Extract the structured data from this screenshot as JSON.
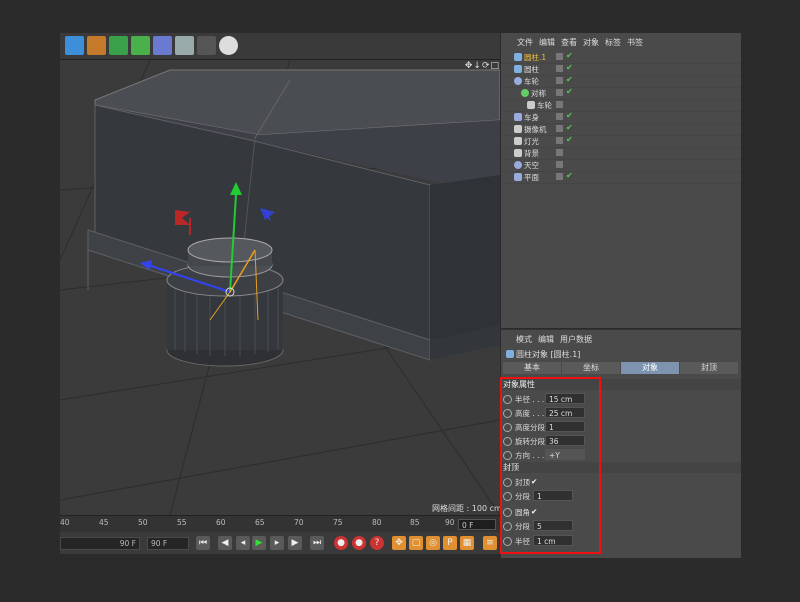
{
  "viewport": {
    "grid_spacing": "网格间距 : 100 cm",
    "nav_icons": "✥↓⟳□"
  },
  "timeline": {
    "ticks": [
      "40",
      "45",
      "50",
      "55",
      "60",
      "65",
      "70",
      "75",
      "80",
      "85",
      "90"
    ],
    "current_frame": "0 F",
    "start_frame_field": "90 F",
    "end_frame_field": "90 F"
  },
  "object_manager": {
    "menu": [
      "文件",
      "编辑",
      "查看",
      "对象",
      "标签",
      "书签"
    ],
    "objects": [
      {
        "name": "圆柱.1",
        "indent": 0,
        "icon": "cylinder-icon",
        "color": "#7fb0e0",
        "highlight": true
      },
      {
        "name": "圆柱",
        "indent": 0,
        "icon": "cylinder-icon",
        "color": "#7fb0e0"
      },
      {
        "name": "车轮",
        "indent": 0,
        "icon": "null-icon",
        "color": "#9ad"
      },
      {
        "name": "对称",
        "indent": 1,
        "icon": "symmetry-icon",
        "color": "#6c6"
      },
      {
        "name": "车轮",
        "indent": 2,
        "icon": "null-icon",
        "color": "#ccc"
      },
      {
        "name": "车身",
        "indent": 0,
        "icon": "null-icon",
        "color": "#9ad"
      },
      {
        "name": "摄像机",
        "indent": 0,
        "icon": "camera-icon",
        "color": "#ccc"
      },
      {
        "name": "灯光",
        "indent": 0,
        "icon": "light-icon",
        "color": "#ccc"
      },
      {
        "name": "背景",
        "indent": 0,
        "icon": "background-icon",
        "color": "#ccc"
      },
      {
        "name": "天空",
        "indent": 0,
        "icon": "sky-icon",
        "color": "#9ad"
      },
      {
        "name": "平面",
        "indent": 0,
        "icon": "plane-icon",
        "color": "#9ad"
      }
    ]
  },
  "attributes": {
    "menu": [
      "模式",
      "编辑",
      "用户数据"
    ],
    "object_title": "圆柱对象 [圆柱.1]",
    "tabs": [
      "基本",
      "坐标",
      "对象",
      "封顶"
    ],
    "active_tab": "对象",
    "section_object": "对象属性",
    "props": [
      {
        "label": "半径 . . .",
        "value": "15 cm"
      },
      {
        "label": "高度 . . .",
        "value": "25 cm"
      },
      {
        "label": "高度分段",
        "value": "1"
      },
      {
        "label": "旋转分段",
        "value": "36"
      },
      {
        "label": "方向 . . .",
        "value": "+Y"
      }
    ],
    "section_caps": "封顶",
    "caps": [
      {
        "label": "封顶",
        "value": "✔"
      },
      {
        "label": "分段",
        "value": "1"
      },
      {
        "label": "圆角",
        "value": "✔"
      },
      {
        "label": "分段",
        "value": "5"
      },
      {
        "label": "半径",
        "value": "1 cm"
      }
    ]
  },
  "colors": {
    "highlight_box": "#e11111",
    "active_tab": "#7d93b0",
    "y_axis": "#22cc33",
    "x_axis": "#dd2222",
    "z_axis": "#3344ee"
  }
}
